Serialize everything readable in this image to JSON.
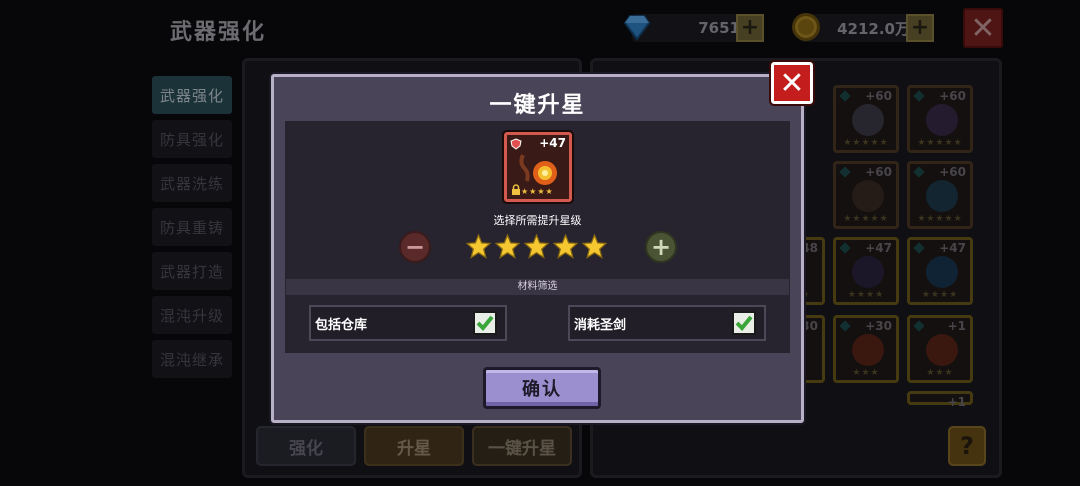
{
  "header": {
    "title": "武器强化"
  },
  "currency": {
    "gems": "7651",
    "gold": "4212.0万"
  },
  "sidebar": {
    "items": [
      {
        "label": "武器强化"
      },
      {
        "label": "防具强化"
      },
      {
        "label": "武器洗练"
      },
      {
        "label": "防具重铸"
      },
      {
        "label": "武器打造"
      },
      {
        "label": "混沌升级"
      },
      {
        "label": "混沌继承"
      }
    ]
  },
  "bottom_tabs": {
    "strengthen": "强化",
    "star_up": "升星",
    "one_key": "一键升星"
  },
  "help": "?",
  "grid": {
    "levels": [
      "+60",
      "+60",
      "+60",
      "+60",
      "+48",
      "+47",
      "+47",
      "+30",
      "+30",
      "+1",
      "+1"
    ]
  },
  "modal": {
    "title": "一键升星",
    "weapon_level": "+47",
    "select_label": "选择所需提升星级",
    "star_count": 5,
    "filter_header": "材料筛选",
    "option_include_warehouse": "包括仓库",
    "option_consume_holy_sword": "消耗圣剑",
    "confirm": "确认"
  },
  "colors": {
    "accent_purple": "#9c8fcf",
    "close_red": "#c41d1d",
    "check_green": "#3aa63a",
    "star_gold": "#f0c040"
  }
}
